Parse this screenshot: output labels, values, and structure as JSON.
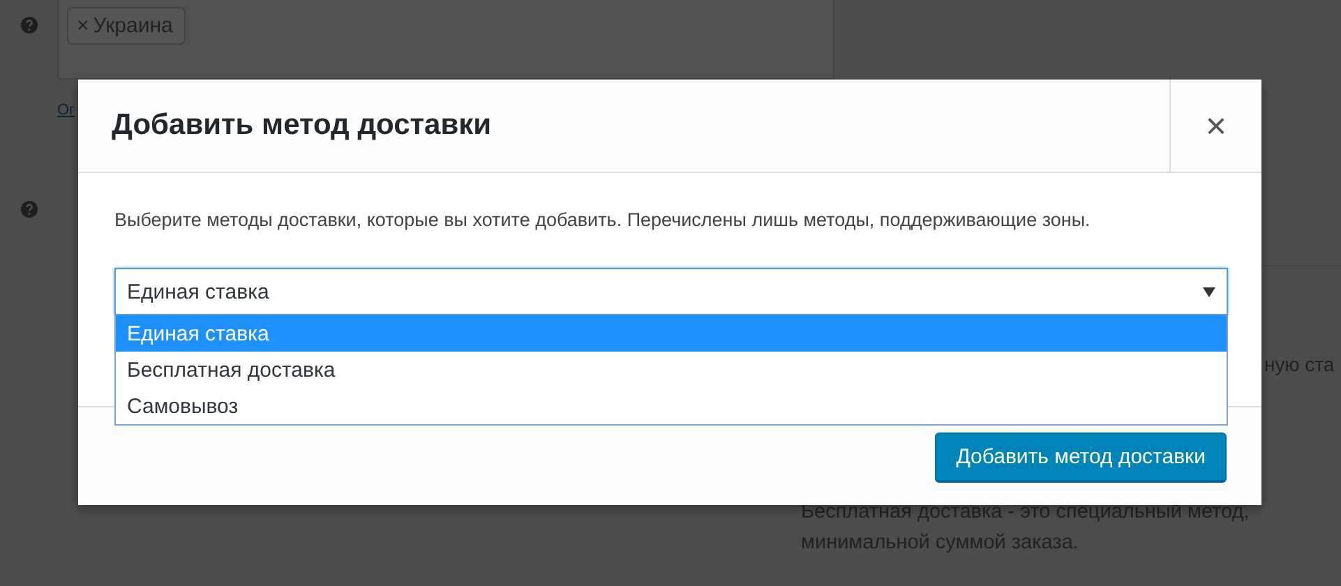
{
  "background": {
    "tag": {
      "remove": "×",
      "label": "Украина"
    },
    "link": "Ог",
    "cut_text": "ную ста",
    "description": [
      "Бесплатная доставка - это специальный метод, ",
      "минимальной суммой заказа."
    ]
  },
  "modal": {
    "title": "Добавить метод доставки",
    "close": "×",
    "intro": "Выберите методы доставки, которые вы хотите добавить. Перечислены лишь методы, поддерживающие зоны.",
    "select": {
      "value": "Единая ставка",
      "expanded": true,
      "options": [
        {
          "label": "Единая ставка",
          "selected": true
        },
        {
          "label": "Бесплатная доставка",
          "selected": false
        },
        {
          "label": "Самовывоз",
          "selected": false
        }
      ]
    },
    "submit": "Добавить метод доставки"
  }
}
